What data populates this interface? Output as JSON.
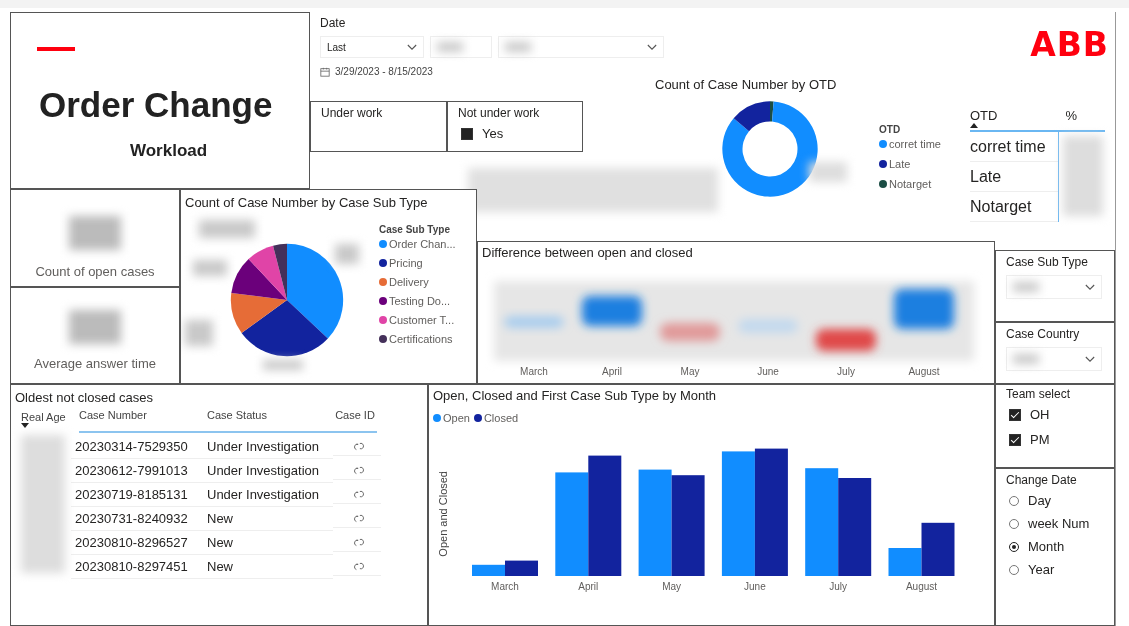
{
  "title": {
    "heading": "Order Change",
    "subtitle": "Workload"
  },
  "date_filter": {
    "label": "Date",
    "mode": "Last",
    "range": "3/29/2023 - 8/15/2023"
  },
  "logo": {
    "text": "ABB"
  },
  "under_work": {
    "title": "Under work"
  },
  "not_under_work": {
    "title": "Not under work",
    "options": [
      {
        "label": "Yes",
        "checked": true
      }
    ]
  },
  "otd_chart": {
    "title": "Count of Case Number by OTD",
    "legend_title": "OTD",
    "legend": [
      {
        "label": "corret time",
        "color": "#118dff"
      },
      {
        "label": "Late",
        "color": "#12239e"
      },
      {
        "label": "Notarget",
        "color": "#1b4d44"
      }
    ]
  },
  "otd_table": {
    "columns": [
      "OTD",
      "%"
    ],
    "rows": [
      "corret time",
      "Late",
      "Notarget"
    ]
  },
  "cards": [
    {
      "label": "Count of open cases"
    },
    {
      "label": "Average answer time"
    }
  ],
  "subtype_chart": {
    "title": "Count of Case Number by Case Sub Type",
    "legend_title": "Case Sub Type",
    "legend": [
      {
        "label": "Order Chan...",
        "color": "#118dff"
      },
      {
        "label": "Pricing",
        "color": "#12239e"
      },
      {
        "label": "Delivery",
        "color": "#e66c37"
      },
      {
        "label": "Testing Do...",
        "color": "#6b007b"
      },
      {
        "label": "Customer T...",
        "color": "#e044a7"
      },
      {
        "label": "Certifications",
        "color": "#44305a"
      }
    ]
  },
  "difference_chart": {
    "title": "Difference between open and closed",
    "categories": [
      "March",
      "April",
      "May",
      "June",
      "July",
      "August"
    ]
  },
  "filters": [
    {
      "title": "Case Sub Type",
      "kind": "dropdown"
    },
    {
      "title": "Case Country",
      "kind": "dropdown"
    }
  ],
  "oldest_cases": {
    "title": "Oldest not closed cases",
    "columns": [
      "Real Age",
      "Case Number",
      "Case Status",
      "Case ID"
    ],
    "rows": [
      {
        "case_number": "20230314-7529350",
        "case_status": "Under Investigation"
      },
      {
        "case_number": "20230612-7991013",
        "case_status": "Under Investigation"
      },
      {
        "case_number": "20230719-8185131",
        "case_status": "Under Investigation"
      },
      {
        "case_number": "20230731-8240932",
        "case_status": "New"
      },
      {
        "case_number": "20230810-8296527",
        "case_status": "New"
      },
      {
        "case_number": "20230810-8297451",
        "case_status": "New"
      }
    ]
  },
  "month_chart": {
    "title": "Open, Closed and First Case Sub Type by Month",
    "legend": [
      {
        "label": "Open",
        "color": "#118dff"
      },
      {
        "label": "Closed",
        "color": "#12239e"
      }
    ],
    "ylabel": "Open and Closed",
    "categories": [
      "March",
      "April",
      "May",
      "June",
      "July",
      "August"
    ]
  },
  "team_select": {
    "title": "Team select",
    "options": [
      {
        "label": "OH",
        "checked": true
      },
      {
        "label": "PM",
        "checked": true
      }
    ]
  },
  "change_date": {
    "title": "Change Date",
    "options": [
      {
        "label": "Day",
        "selected": false
      },
      {
        "label": "week Num",
        "selected": false
      },
      {
        "label": "Month",
        "selected": true
      },
      {
        "label": "Year",
        "selected": false
      }
    ]
  }
}
